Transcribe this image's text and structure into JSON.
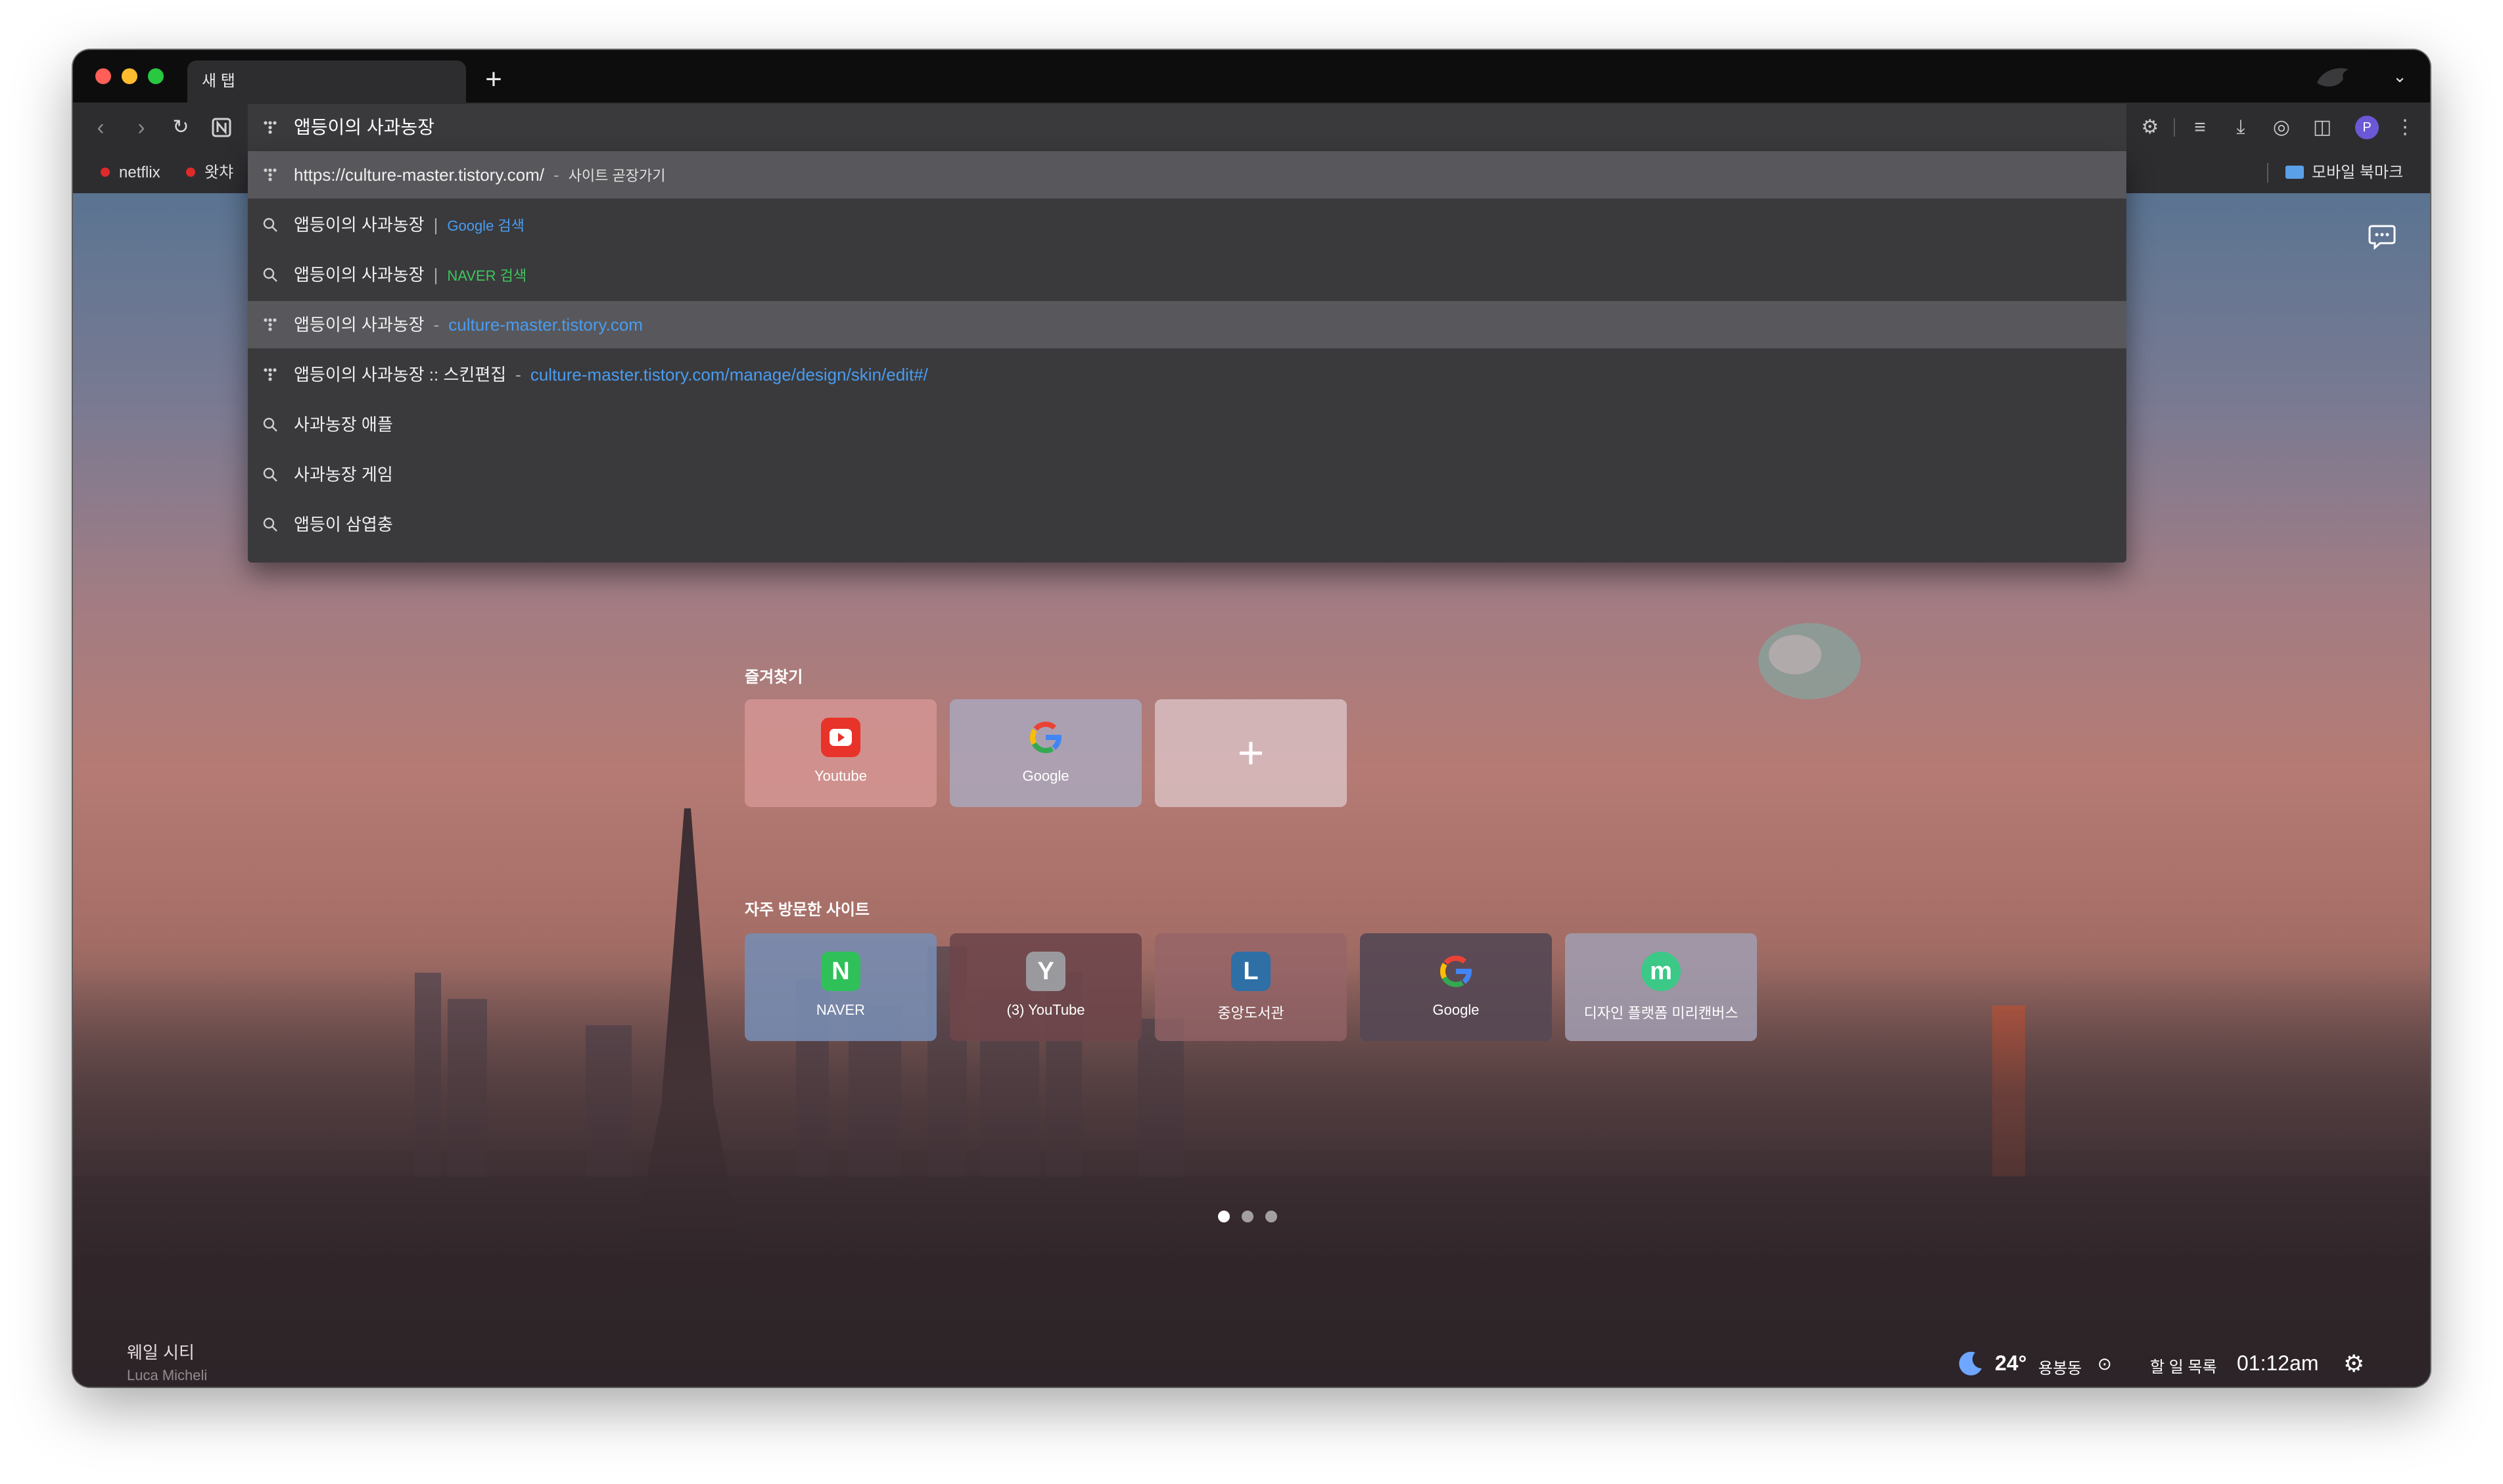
{
  "tab": {
    "title": "새 탭",
    "new_tab": "+"
  },
  "omnibox": {
    "value": "앱등이의 사과농장"
  },
  "suggestions": [
    {
      "kind": "site",
      "text": "https://culture-master.tistory.com/",
      "sep": "-",
      "extra": "사이트 곧장가기"
    },
    {
      "kind": "search",
      "text": "앱등이의 사과농장",
      "sep": "|",
      "extra": "Google 검색"
    },
    {
      "kind": "search",
      "text": "앱등이의 사과농장",
      "sep": "|",
      "extra": "NAVER 검색"
    },
    {
      "kind": "site",
      "text": "앱등이의 사과농장",
      "sep": "-",
      "extra": "culture-master.tistory.com"
    },
    {
      "kind": "site",
      "text": "앱등이의 사과농장 :: 스킨편집",
      "sep": "-",
      "extra": "culture-master.tistory.com/manage/design/skin/edit#/"
    },
    {
      "kind": "search",
      "text": "사과농장 애플"
    },
    {
      "kind": "search",
      "text": "사과농장 게임"
    },
    {
      "kind": "search",
      "text": "앱등이 삼엽충"
    }
  ],
  "bookmarks": {
    "items": [
      "netflix",
      "왓챠"
    ],
    "mobile": "모바일 북마크"
  },
  "profile": {
    "initial": "P"
  },
  "favorites": {
    "title": "즐겨찾기",
    "tiles": [
      {
        "label": "Youtube"
      },
      {
        "label": "Google"
      }
    ],
    "add": "+"
  },
  "frequent": {
    "title": "자주 방문한 사이트",
    "tiles": [
      {
        "label": "NAVER",
        "icon": "N"
      },
      {
        "label": "(3) YouTube",
        "icon": "Y"
      },
      {
        "label": "중앙도서관",
        "icon": "L"
      },
      {
        "label": "Google",
        "icon": "G"
      },
      {
        "label": "디자인 플랫폼 미리캔버스",
        "icon": "m"
      }
    ]
  },
  "wallpaper": {
    "title": "웨일 시티",
    "author": "Luca Micheli"
  },
  "status": {
    "temperature": "24°",
    "location": "용봉동",
    "todo": "할 일 목록",
    "time": "01:12am"
  },
  "colors": {
    "accent_blue": "#4a9cf0",
    "naver_green": "#3ec65c",
    "youtube_red": "#e8332a"
  }
}
